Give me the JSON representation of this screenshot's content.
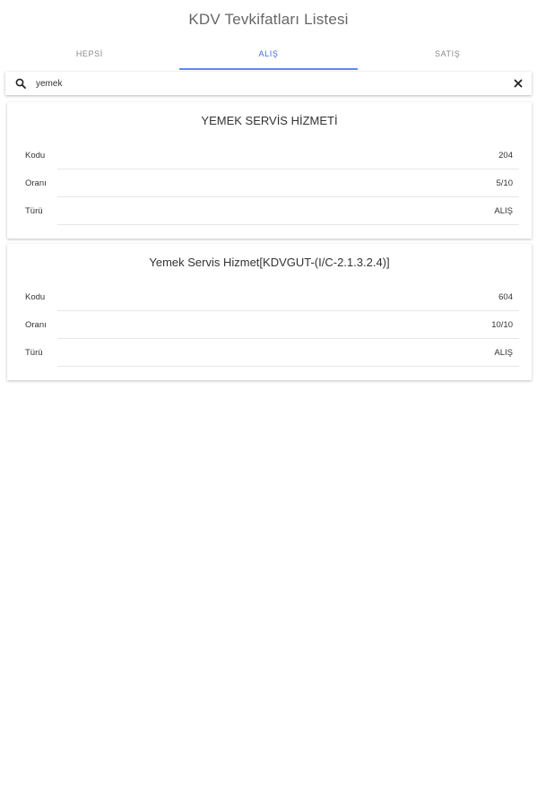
{
  "header": {
    "title": "KDV Tevkifatları Listesi"
  },
  "tabs": [
    {
      "label": "HEPSİ",
      "active": false
    },
    {
      "label": "ALIŞ",
      "active": true
    },
    {
      "label": "SATIŞ",
      "active": false
    }
  ],
  "search": {
    "value": "yemek",
    "search_icon": "search-icon",
    "clear_icon": "close-icon"
  },
  "colors": {
    "accent": "#5b8af0",
    "active_tab_text": "#3f6fd8"
  },
  "results": [
    {
      "title": "YEMEK SERVİS HİZMETİ",
      "rows": [
        {
          "label": "Kodu",
          "value": "204"
        },
        {
          "label": "Oranı",
          "value": "5/10"
        },
        {
          "label": "Türü",
          "value": "ALIŞ"
        }
      ]
    },
    {
      "title": "Yemek Servis Hizmet[KDVGUT-(I/C-2.1.3.2.4)]",
      "rows": [
        {
          "label": "Kodu",
          "value": "604"
        },
        {
          "label": "Oranı",
          "value": "10/10"
        },
        {
          "label": "Türü",
          "value": "ALIŞ"
        }
      ]
    }
  ]
}
